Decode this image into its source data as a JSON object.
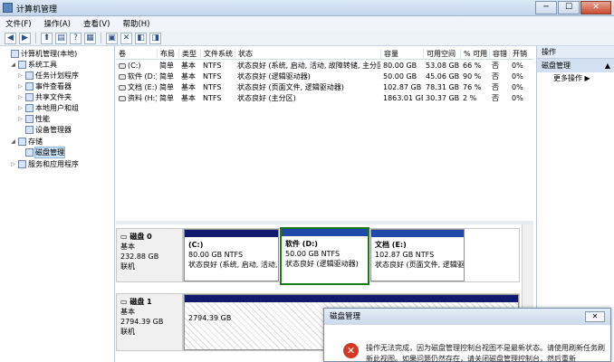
{
  "window": {
    "title": "计算机管理",
    "buttons": [
      "─",
      "☐",
      "✕"
    ]
  },
  "menu": [
    "文件(F)",
    "操作(A)",
    "查看(V)",
    "帮助(H)"
  ],
  "toolbar_icons": [
    "back-arrow-icon",
    "forward-arrow-icon",
    "up-folder-icon",
    "show-tree-icon",
    "help-icon",
    "refresh-icon",
    "delete-icon",
    "properties-icon",
    "disk-icon"
  ],
  "tree": [
    {
      "label": "计算机管理(本地)",
      "level": 0,
      "exp": ""
    },
    {
      "label": "系统工具",
      "level": 1,
      "exp": "◢"
    },
    {
      "label": "任务计划程序",
      "level": 2,
      "exp": "▷"
    },
    {
      "label": "事件查看器",
      "level": 2,
      "exp": "▷"
    },
    {
      "label": "共享文件夹",
      "level": 2,
      "exp": "▷"
    },
    {
      "label": "本地用户和组",
      "level": 2,
      "exp": "▷"
    },
    {
      "label": "性能",
      "level": 2,
      "exp": "▷"
    },
    {
      "label": "设备管理器",
      "level": 2,
      "exp": ""
    },
    {
      "label": "存储",
      "level": 1,
      "exp": "◢"
    },
    {
      "label": "磁盘管理",
      "level": 2,
      "exp": "",
      "selected": true
    },
    {
      "label": "服务和应用程序",
      "level": 1,
      "exp": "▷"
    }
  ],
  "volumes": {
    "columns": [
      "卷",
      "布局",
      "类型",
      "文件系统",
      "状态",
      "容量",
      "可用空间",
      "% 可用",
      "容错",
      "开销"
    ],
    "rows": [
      [
        "(C:)",
        "简单",
        "基本",
        "NTFS",
        "状态良好 (系统, 启动, 活动, 故障转储, 主分区)",
        "80.00 GB",
        "53.08 GB",
        "66 %",
        "否",
        "0%"
      ],
      [
        "软件 (D:)",
        "简单",
        "基本",
        "NTFS",
        "状态良好 (逻辑驱动器)",
        "50.00 GB",
        "45.06 GB",
        "90 %",
        "否",
        "0%"
      ],
      [
        "文档 (E:)",
        "简单",
        "基本",
        "NTFS",
        "状态良好 (页面文件, 逻辑驱动器)",
        "102.87 GB",
        "78.31 GB",
        "76 %",
        "否",
        "0%"
      ],
      [
        "资料 (H:)",
        "简单",
        "基本",
        "NTFS",
        "状态良好 (主分区)",
        "1863.01 GB",
        "30.37 GB",
        "2 %",
        "否",
        "0%"
      ]
    ]
  },
  "disks": [
    {
      "name": "磁盘 0",
      "type": "基本",
      "size": "232.88 GB",
      "status": "联机",
      "partitions": [
        {
          "label": "(C:)",
          "size": "80.00 GB NTFS",
          "status": "状态良好 (系统, 启动, 活动, ",
          "style": "primary"
        },
        {
          "label": "软件 (D:)",
          "size": "50.00 GB NTFS",
          "status": "状态良好 (逻辑驱动器)",
          "style": "logical-selected"
        },
        {
          "label": "文档 (E:)",
          "size": "102.87 GB NTFS",
          "status": "状态良好 (页面文件, 逻辑驱",
          "style": "logical"
        }
      ]
    },
    {
      "name": "磁盘 1",
      "type": "基本",
      "size": "2794.39 GB",
      "status": "联机",
      "partitions": [
        {
          "label": "",
          "size": "2794.39 GB",
          "status": "",
          "style": "unallocated"
        }
      ]
    }
  ],
  "actions": {
    "header": "操作",
    "section": "磁盘管理",
    "section_arrow": "▲",
    "more": "更多操作",
    "more_arrow": "▶"
  },
  "dialog": {
    "title": "磁盘管理",
    "close": "✕",
    "icon": "✕",
    "message": "操作无法完成，因为磁盘管理控制台视图不是最新状态。请使用刷新任务刷新此视图。如果问题仍然存在，请关闭磁盘管理控制台，然后重新"
  },
  "colors": {
    "primary_partition": "#1f4aa8",
    "logical_partition": "#1f4aa8",
    "selected_border": "#1a7a1a",
    "error": "#d33a26"
  }
}
